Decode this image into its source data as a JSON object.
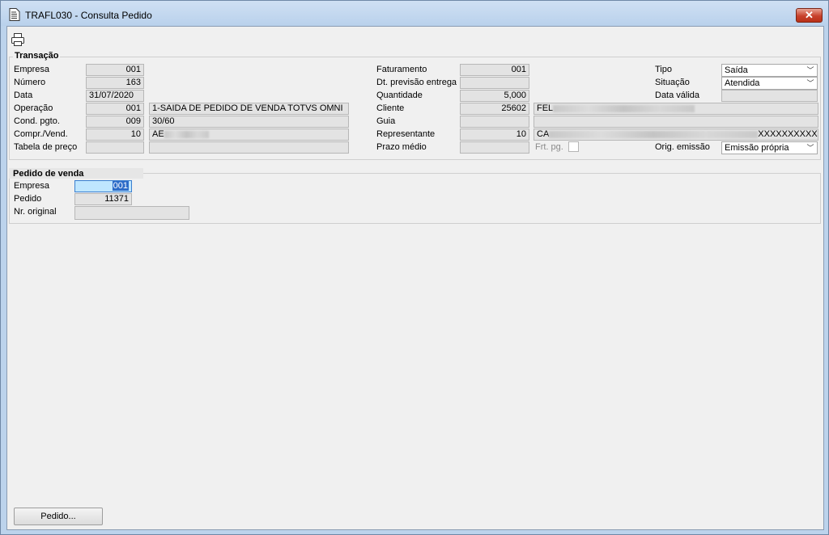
{
  "window": {
    "title": "TRAFL030 - Consulta Pedido",
    "close_label": "✕"
  },
  "transacao": {
    "title": "Transação",
    "empresa": {
      "label": "Empresa",
      "value": "001"
    },
    "numero": {
      "label": "Número",
      "value": "163"
    },
    "data": {
      "label": "Data",
      "value": "31/07/2020"
    },
    "operacao": {
      "label": "Operação",
      "code": "001",
      "desc": "1-SAIDA DE PEDIDO DE VENDA TOTVS OMNI"
    },
    "cond_pgto": {
      "label": "Cond. pgto.",
      "code": "009",
      "desc": "30/60"
    },
    "compr_vend": {
      "label": "Compr./Vend.",
      "code": "10",
      "desc": "AE"
    },
    "tabela_preco": {
      "label": "Tabela de preço",
      "code": "",
      "desc": ""
    },
    "faturamento": {
      "label": "Faturamento",
      "value": "001"
    },
    "dt_previsao": {
      "label": "Dt. previsão entrega",
      "value": ""
    },
    "quantidade": {
      "label": "Quantidade",
      "value": "5,000"
    },
    "cliente": {
      "label": "Cliente",
      "code": "25602",
      "desc": "FEL"
    },
    "guia": {
      "label": "Guia",
      "code": "",
      "desc": ""
    },
    "representante": {
      "label": "Representante",
      "code": "10",
      "desc": "CA",
      "desc_suffix": "XXXXXXXXXX"
    },
    "prazo_medio": {
      "label": "Prazo médio",
      "value": ""
    },
    "frt_pg": {
      "label": "Frt. pg."
    },
    "tipo": {
      "label": "Tipo",
      "value": "Saída"
    },
    "situacao": {
      "label": "Situação",
      "value": "Atendida"
    },
    "data_valida": {
      "label": "Data válida",
      "value": ""
    },
    "orig_emissao": {
      "label": "Orig. emissão",
      "value": "Emissão própria"
    }
  },
  "pedido_venda": {
    "title": "Pedido de venda",
    "empresa": {
      "label": "Empresa",
      "value": "001"
    },
    "pedido": {
      "label": "Pedido",
      "value": "11371"
    },
    "nr_original": {
      "label": "Nr. original",
      "value": ""
    }
  },
  "footer": {
    "pedido_button": "Pedido..."
  },
  "icons": {
    "title": "document-icon",
    "print": "printer-icon",
    "combo": "chevron-down-icon"
  }
}
